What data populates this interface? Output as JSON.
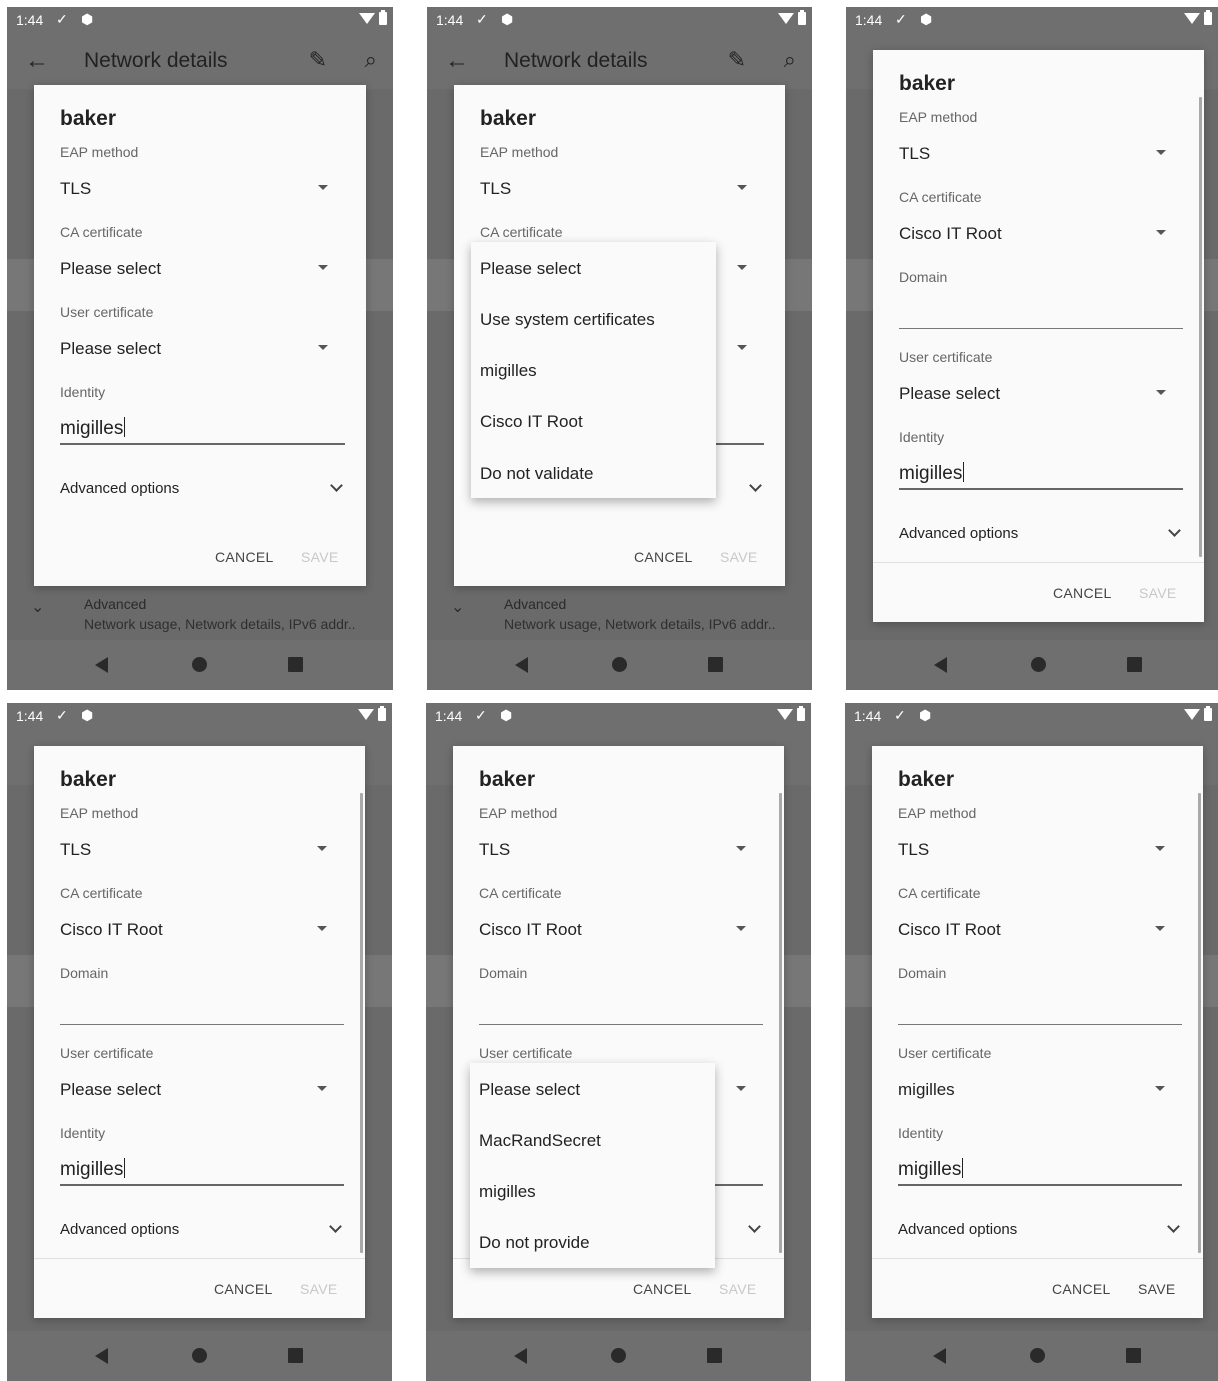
{
  "status": {
    "time": "1:44"
  },
  "appbar": {
    "title": "Network details"
  },
  "background": {
    "advanced_title": "Advanced",
    "advanced_sub": "Network usage, Network details, IPv6 addr.."
  },
  "dialog": {
    "title": "baker",
    "eap_label": "EAP method",
    "eap_value": "TLS",
    "ca_label": "CA certificate",
    "ca_placeholder": "Please select",
    "ca_selected": "Cisco IT Root",
    "domain_label": "Domain",
    "user_label": "User certificate",
    "user_placeholder": "Please select",
    "user_selected": "migilles",
    "identity_label": "Identity",
    "identity_value": "migilles",
    "advanced_label": "Advanced options",
    "cancel_label": "CANCEL",
    "save_label": "SAVE"
  },
  "ca_menu": [
    "Please select",
    "Use system certificates",
    "migilles",
    "Cisco IT Root",
    "Do not validate"
  ],
  "user_menu": [
    "Please select",
    "MacRandSecret",
    "migilles",
    "Do not provide"
  ]
}
